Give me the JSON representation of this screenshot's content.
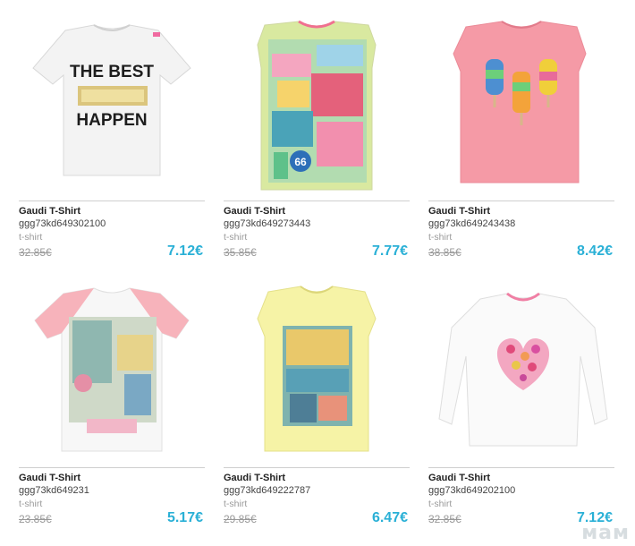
{
  "products": [
    {
      "title": "Gaudi T-Shirt",
      "sku": "ggg73kd649302100",
      "category": "t-shirt",
      "old_price": "32.85€",
      "new_price": "7.12€",
      "print_text_1": "THE BEST",
      "print_text_2": "HAPPEN"
    },
    {
      "title": "Gaudi T-Shirt",
      "sku": "ggg73kd649273443",
      "category": "t-shirt",
      "old_price": "35.85€",
      "new_price": "7.77€"
    },
    {
      "title": "Gaudi T-Shirt",
      "sku": "ggg73kd649243438",
      "category": "t-shirt",
      "old_price": "38.85€",
      "new_price": "8.42€"
    },
    {
      "title": "Gaudi T-Shirt",
      "sku": "ggg73kd649231",
      "category": "t-shirt",
      "old_price": "23.85€",
      "new_price": "5.17€"
    },
    {
      "title": "Gaudi T-Shirt",
      "sku": "ggg73kd649222787",
      "category": "t-shirt",
      "old_price": "29.85€",
      "new_price": "6.47€"
    },
    {
      "title": "Gaudi T-Shirt",
      "sku": "ggg73kd649202100",
      "category": "t-shirt",
      "old_price": "32.85€",
      "new_price": "7.12€"
    }
  ],
  "watermark": "мам",
  "colors": {
    "price": "#2ab0d6",
    "old_price": "#999999"
  }
}
